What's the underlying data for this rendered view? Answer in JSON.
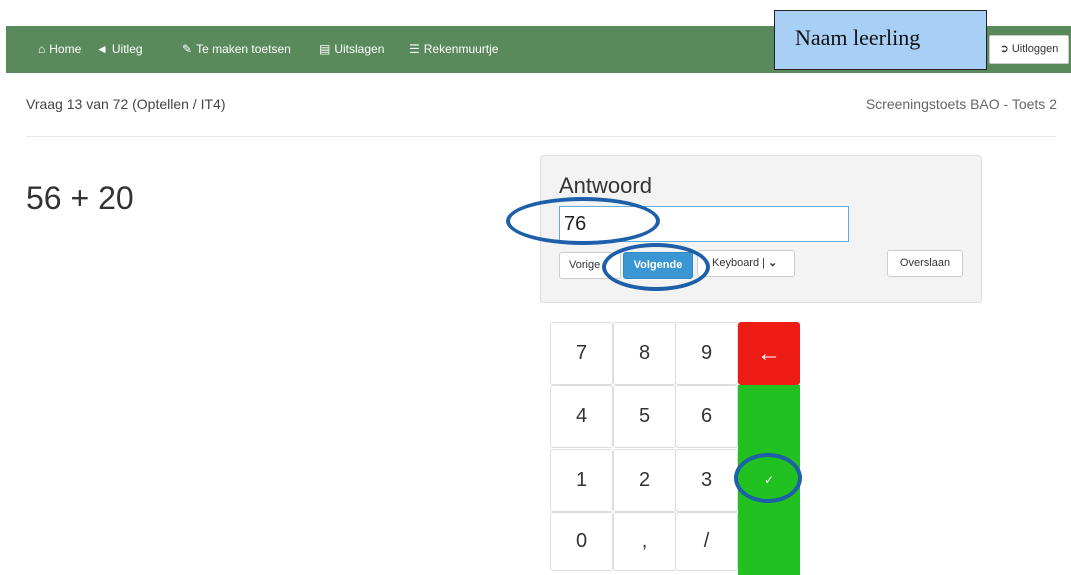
{
  "nav": {
    "items": [
      {
        "label": "Home",
        "icon": "home-icon"
      },
      {
        "label": "Uitleg",
        "icon": "megaphone-icon"
      },
      {
        "label": "Te maken toetsen",
        "icon": "pencil-icon"
      },
      {
        "label": "Uitslagen",
        "icon": "list-icon"
      },
      {
        "label": "Rekenmuurtje",
        "icon": "bars-icon"
      }
    ],
    "student_name": "Naam leerling",
    "logout_label": "Uitloggen"
  },
  "header": {
    "question_meta": "Vraag 13 van 72 (Optellen / IT4)",
    "test_name": "Screeningstoets BAO - Toets 2"
  },
  "question": {
    "text": "56 + 20"
  },
  "answer": {
    "label": "Antwoord",
    "value": "76",
    "prev_label": "Vorige",
    "next_label": "Volgende",
    "keyboard_label": "Keyboard |",
    "skip_label": "Overslaan"
  },
  "keypad": {
    "keys": [
      "7",
      "8",
      "9",
      "4",
      "5",
      "6",
      "1",
      "2",
      "3",
      "0",
      ",",
      "/"
    ],
    "backspace": "←",
    "confirm": "✓"
  },
  "colors": {
    "navbar": "#5a8a5c",
    "primary_button": "#3a97d4",
    "backspace_key": "#ee1c14",
    "confirm_key": "#22c122",
    "annotation": "#1d5fa8",
    "student_box": "#a8cff5"
  }
}
